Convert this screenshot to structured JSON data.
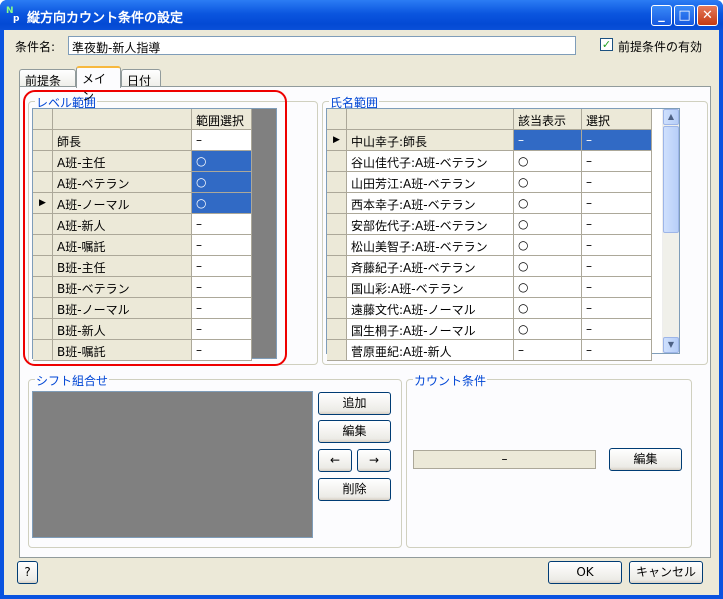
{
  "window": {
    "title": "縦方向カウント条件の設定",
    "minimize": "_",
    "maximize": "□",
    "close": "✕"
  },
  "condition": {
    "label": "条件名:",
    "value": "準夜勤-新人指導"
  },
  "prerequisite_check": {
    "label": "前提条件の有効",
    "checked": true,
    "mark": "✓"
  },
  "tabs": [
    {
      "label": "前提条件"
    },
    {
      "label": "メイン"
    },
    {
      "label": "日付"
    }
  ],
  "level": {
    "title": "レベル範囲",
    "col_header": "範囲選択",
    "rows": [
      {
        "name": "師長",
        "value": "–"
      },
      {
        "name": "A班-主任",
        "value": "○"
      },
      {
        "name": "A班-ベテラン",
        "value": "○"
      },
      {
        "name": "A班-ノーマル",
        "value": "○"
      },
      {
        "name": "A班-新人",
        "value": "–"
      },
      {
        "name": "A班-嘱託",
        "value": "–"
      },
      {
        "name": "B班-主任",
        "value": "–"
      },
      {
        "name": "B班-ベテラン",
        "value": "–"
      },
      {
        "name": "B班-ノーマル",
        "value": "–"
      },
      {
        "name": "B班-新人",
        "value": "–"
      },
      {
        "name": "B班-嘱託",
        "value": "–"
      }
    ]
  },
  "names": {
    "title": "氏名範囲",
    "col_headers": [
      "該当表示",
      "選択"
    ],
    "rows": [
      {
        "name": "中山幸子:師長",
        "show": "–",
        "select": "–"
      },
      {
        "name": "谷山佳代子:A班-ベテラン",
        "show": "○",
        "select": "–"
      },
      {
        "name": "山田芳江:A班-ベテラン",
        "show": "○",
        "select": "–"
      },
      {
        "name": "西本幸子:A班-ベテラン",
        "show": "○",
        "select": "–"
      },
      {
        "name": "安部佐代子:A班-ベテラン",
        "show": "○",
        "select": "–"
      },
      {
        "name": "松山美智子:A班-ベテラン",
        "show": "○",
        "select": "–"
      },
      {
        "name": "斉藤紀子:A班-ベテラン",
        "show": "○",
        "select": "–"
      },
      {
        "name": "国山彩:A班-ベテラン",
        "show": "○",
        "select": "–"
      },
      {
        "name": "遠藤文代:A班-ノーマル",
        "show": "○",
        "select": "–"
      },
      {
        "name": "国生桐子:A班-ノーマル",
        "show": "○",
        "select": "–"
      },
      {
        "name": "菅原亜紀:A班-新人",
        "show": "–",
        "select": "–"
      }
    ]
  },
  "shift": {
    "title": "シフト組合せ",
    "add": "追加",
    "edit": "編集",
    "left": "←",
    "right": "→",
    "delete": "削除"
  },
  "count": {
    "title": "カウント条件",
    "value": "–",
    "edit": "編集"
  },
  "footer": {
    "help": "?",
    "ok": "OK",
    "cancel": "キャンセル"
  },
  "row_marker": "▶",
  "scroll": {
    "up": "▲",
    "down": "▼"
  }
}
